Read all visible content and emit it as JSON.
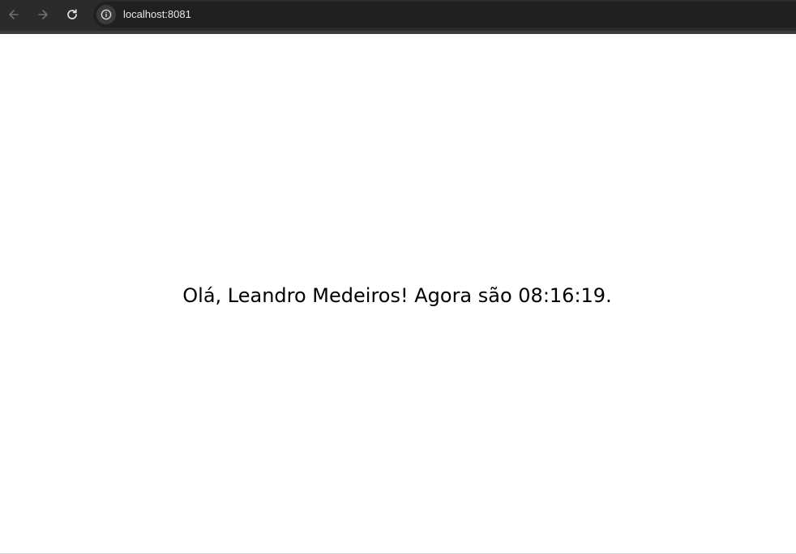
{
  "browser": {
    "url": "localhost:8081",
    "icons": {
      "back": "arrow-left-icon",
      "forward": "arrow-right-icon",
      "reload": "reload-icon",
      "site_info": "info-icon"
    },
    "colors": {
      "toolbar_bg": "#2b2b2b",
      "omnibox_bg": "#202020",
      "url_text": "#e8e8e8"
    }
  },
  "page": {
    "greeting": "Olá, Leandro Medeiros! Agora são 08:16:19."
  }
}
